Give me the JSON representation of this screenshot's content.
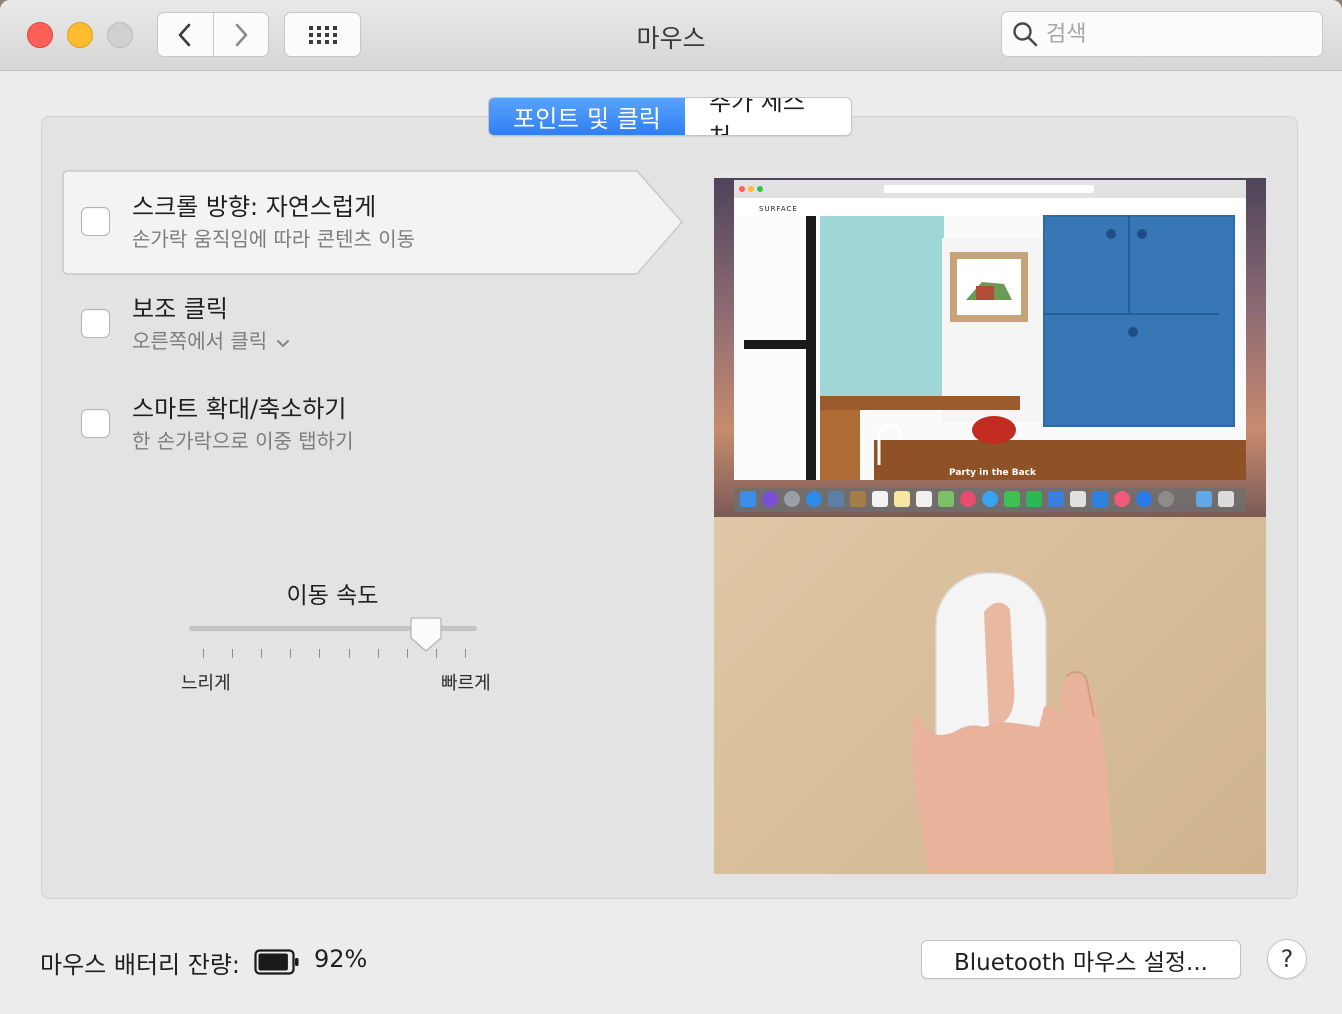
{
  "window": {
    "title": "마우스",
    "search_placeholder": "검색"
  },
  "tabs": [
    {
      "label": "포인트 및 클릭",
      "active": true
    },
    {
      "label": "추가 제스처",
      "active": false
    }
  ],
  "options": [
    {
      "title": "스크롤 방향: 자연스럽게",
      "subtitle": "손가락 움직임에 따라 콘텐츠 이동",
      "checked": false,
      "selected": true
    },
    {
      "title": "보조 클릭",
      "subtitle": "오른쪽에서 클릭",
      "checked": false,
      "selected": false,
      "has_dropdown": true
    },
    {
      "title": "스마트 확대/축소하기",
      "subtitle": "한 손가락으로 이중 탭하기",
      "checked": false,
      "selected": false
    }
  ],
  "speed": {
    "title": "이동 속도",
    "slow_label": "느리게",
    "fast_label": "빠르게",
    "value_fraction": 0.85,
    "tick_count": 10
  },
  "preview": {
    "website_title": "SURFACE",
    "caption": "Party in the Back"
  },
  "bottom": {
    "battery_label": "마우스 배터리 잔량:",
    "battery_percent": "92%",
    "battery_level": 0.92,
    "bluetooth_button": "Bluetooth 마우스 설정...",
    "help_label": "?"
  },
  "colors": {
    "accent": "#2f7ff4",
    "close": "#fe5f57",
    "minimize": "#febc2e"
  }
}
